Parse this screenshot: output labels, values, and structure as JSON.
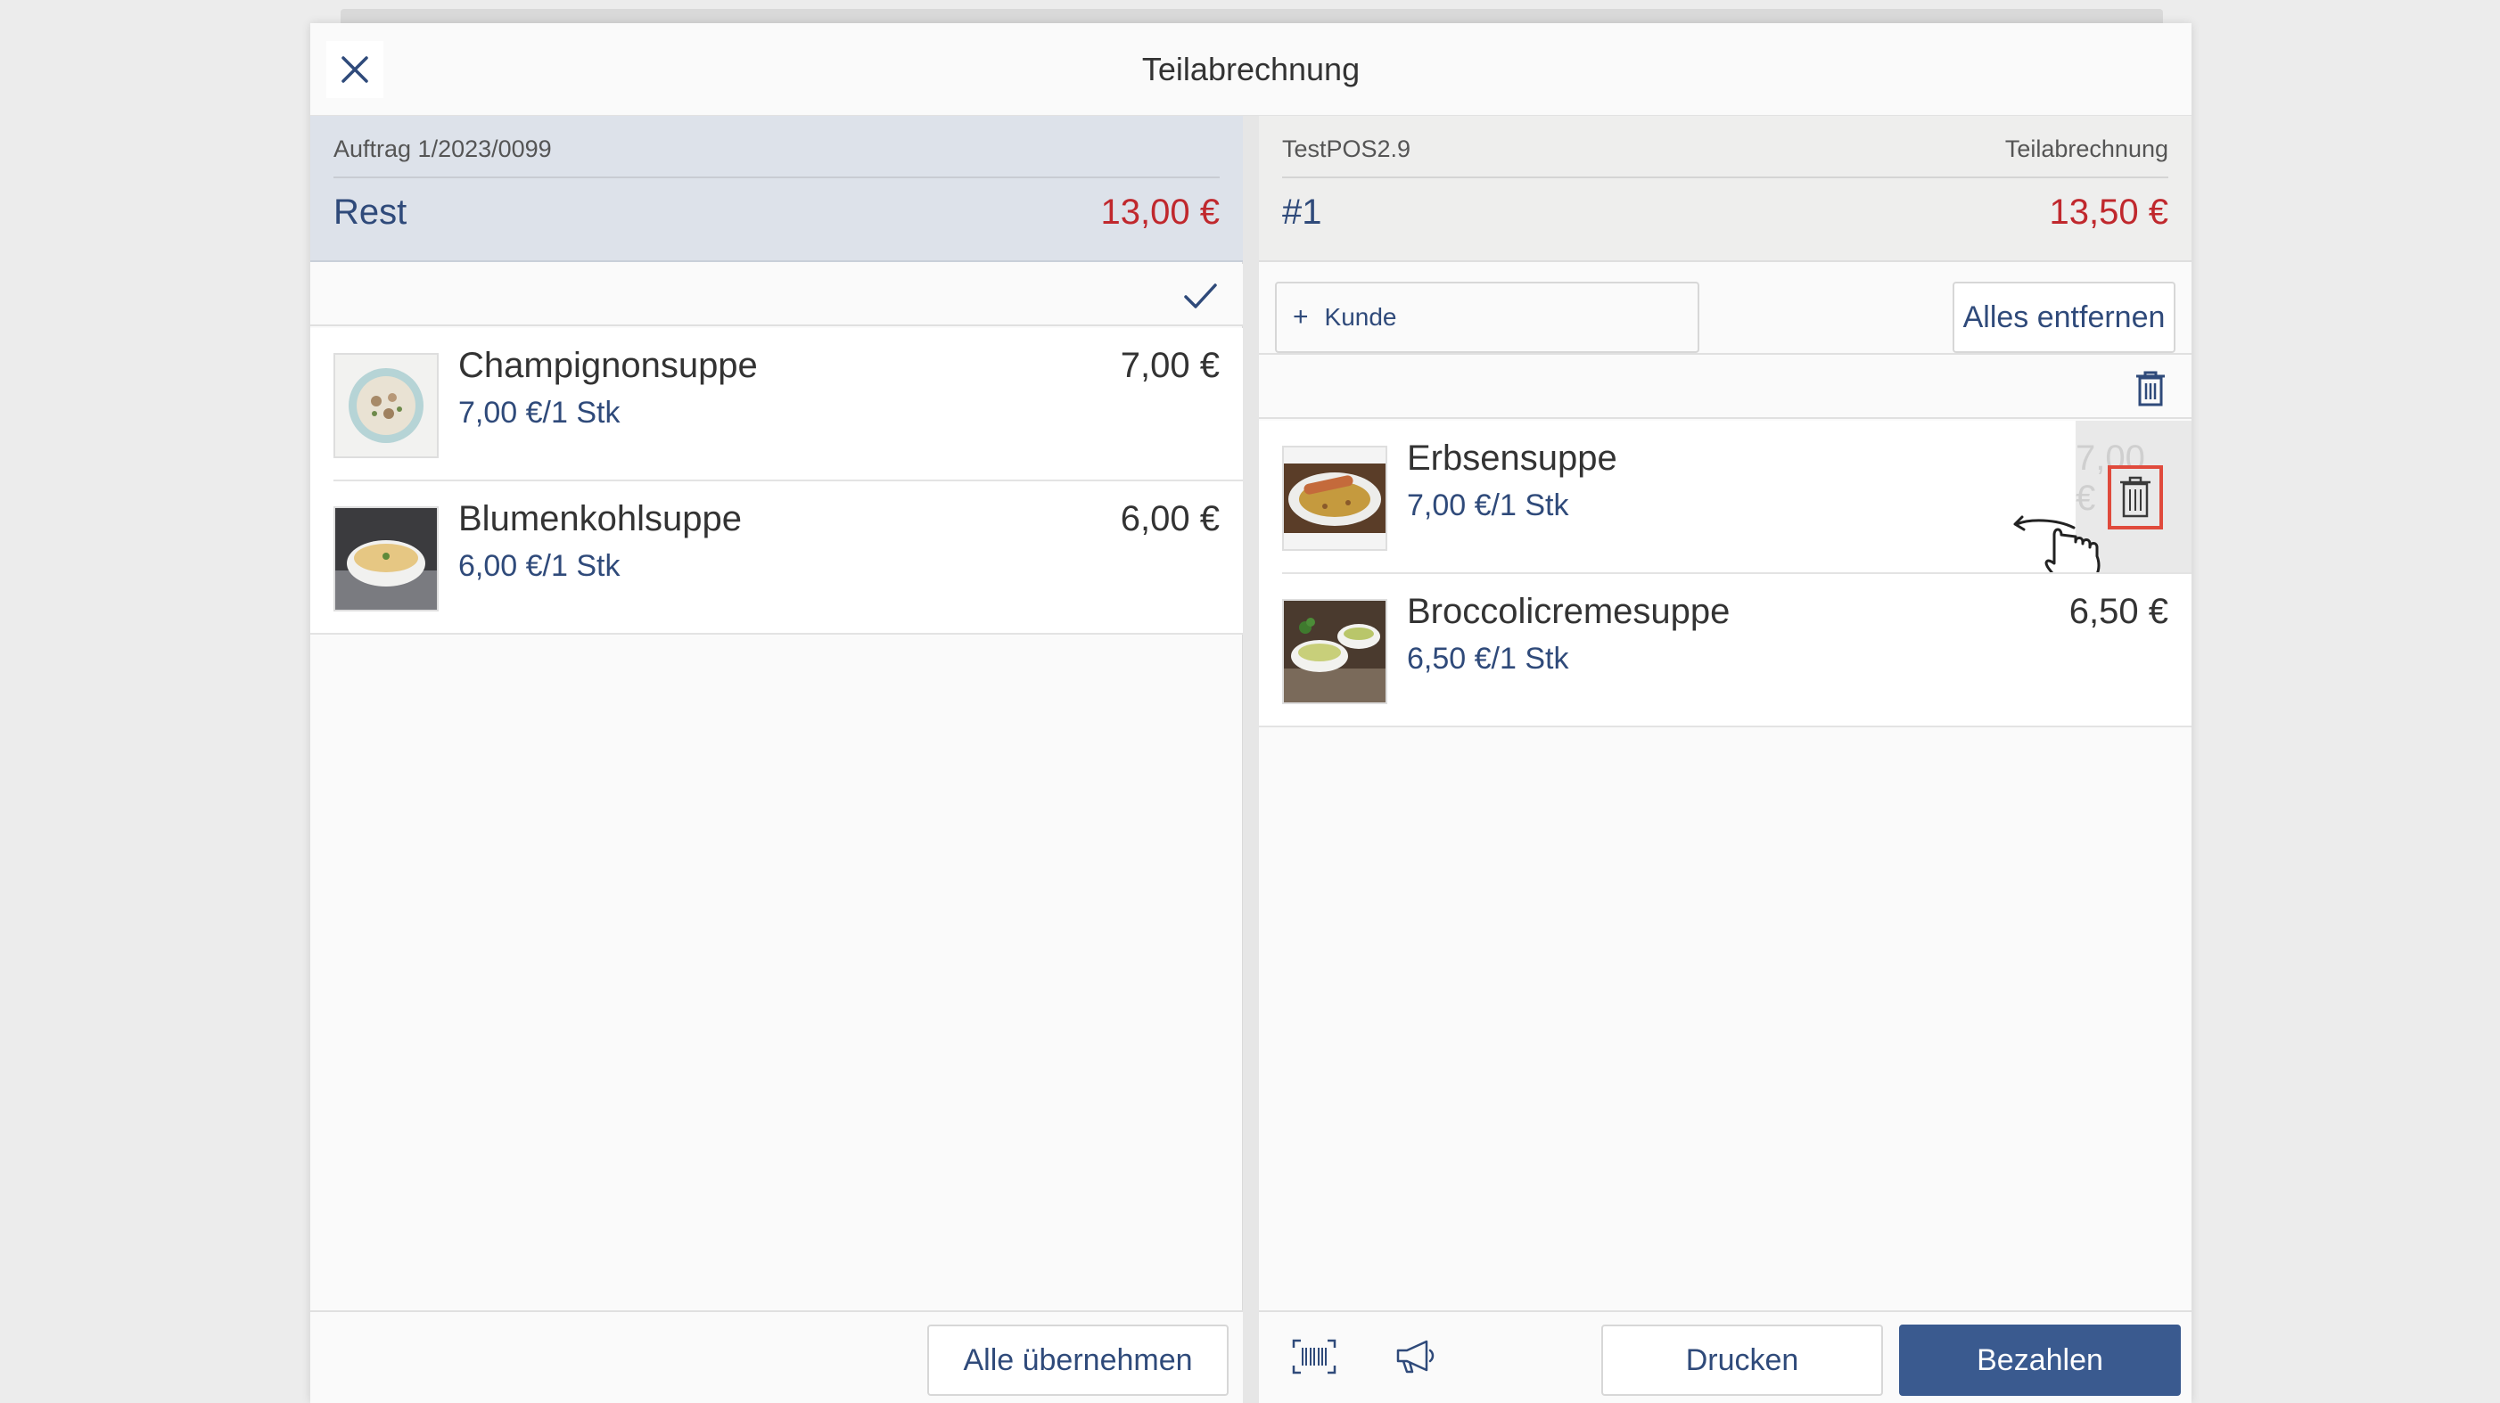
{
  "dialog": {
    "title": "Teilabrechnung",
    "close_icon": "close-icon"
  },
  "left": {
    "order_label": "Auftrag 1/2023/0099",
    "name": "Rest",
    "total": "13,00 €",
    "items": [
      {
        "name": "Champignonsuppe",
        "unit": "7,00 €/1 Stk",
        "price": "7,00 €"
      },
      {
        "name": "Blumenkohlsuppe",
        "unit": "6,00 €/1 Stk",
        "price": "6,00 €"
      }
    ],
    "take_all_label": "Alle übernehmen"
  },
  "right": {
    "register": "TestPOS2.9",
    "mode": "Teilabrechnung",
    "name": "#1",
    "total": "13,50 €",
    "customer_label": "Kunde",
    "remove_all_label": "Alles entfernen",
    "items": [
      {
        "name": "Erbsensuppe",
        "unit": "7,00 €/1 Stk",
        "price": "7,00 €"
      },
      {
        "name": "Broccolicremesuppe",
        "unit": "6,50 €/1 Stk",
        "price": "6,50 €"
      }
    ],
    "print_label": "Drucken",
    "pay_label": "Bezahlen"
  },
  "colors": {
    "accent": "#3a5a8f",
    "total_red": "#c0282d",
    "highlight": "#e04a3c"
  }
}
